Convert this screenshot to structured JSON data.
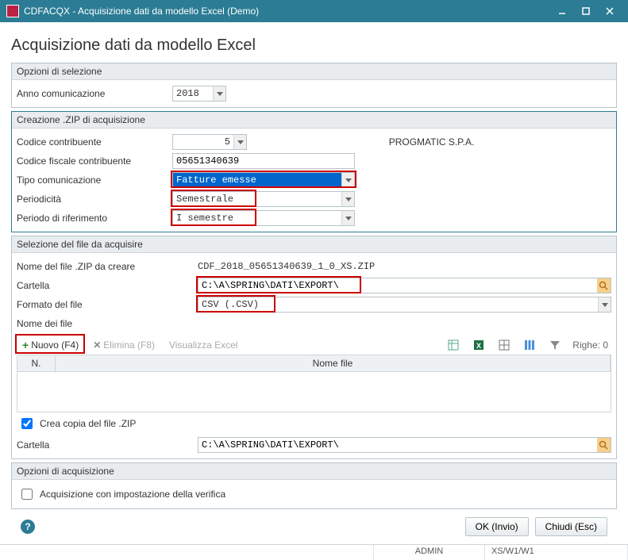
{
  "window": {
    "title": "CDFACQX - Acquisizione dati da modello Excel  (Demo)"
  },
  "page_title": "Acquisizione dati da modello Excel",
  "sec_opzioni_selezione": {
    "title": "Opzioni di selezione",
    "anno_label": "Anno comunicazione",
    "anno_value": "2018"
  },
  "sec_creazione": {
    "title": "Creazione .ZIP di acquisizione",
    "codice_contrib_label": "Codice contribuente",
    "codice_contrib_value": "5",
    "ragione_sociale": "PROGMATIC S.P.A.",
    "cf_label": "Codice fiscale contribuente",
    "cf_value": "05651340639",
    "tipo_com_label": "Tipo comunicazione",
    "tipo_com_value": "Fatture emesse",
    "periodicita_label": "Periodicità",
    "periodicita_value": "Semestrale",
    "periodo_rif_label": "Periodo di riferimento",
    "periodo_rif_value": "I semestre"
  },
  "sec_selezione_file": {
    "title": "Selezione del file da acquisire",
    "zip_label": "Nome del file .ZIP da creare",
    "zip_value": "CDF_2018_05651340639_1_0_XS.ZIP",
    "cartella_label": "Cartella",
    "cartella_value": "C:\\A\\SPRING\\DATI\\EXPORT\\",
    "formato_label": "Formato del file",
    "formato_value": "CSV (.CSV)",
    "nomefile_label": "Nome dei file",
    "toolbar": {
      "nuovo": "Nuovo (F4)",
      "elimina": "Elimina (F8)",
      "visualizza": "Visualizza Excel",
      "righe_label": "Righe:",
      "righe_count": "0"
    },
    "grid_cols": {
      "n": "N.",
      "nomefile": "Nome file"
    },
    "crea_copia_label": "Crea copia del file .ZIP",
    "cartella2_label": "Cartella",
    "cartella2_value": "C:\\A\\SPRING\\DATI\\EXPORT\\"
  },
  "sec_opzioni_acq": {
    "title": "Opzioni di acquisizione",
    "impostazione_label": "Acquisizione con impostazione della verifica"
  },
  "footer": {
    "ok": "OK (Invio)",
    "chiudi": "Chiudi (Esc)"
  },
  "status": {
    "user": "ADMIN",
    "env": "XS/W1/W1"
  }
}
